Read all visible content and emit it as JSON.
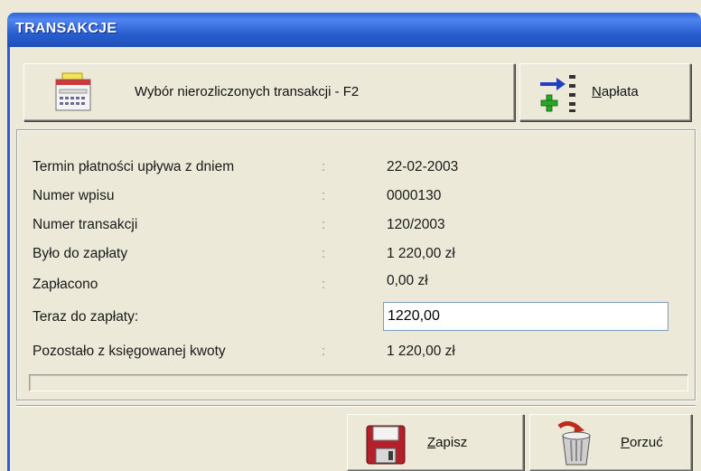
{
  "window": {
    "title": "TRANSAKCJE"
  },
  "toolbar": {
    "select_label": "Wybór nierozliczonych transakcji - F2",
    "payment_label_underlined": "N",
    "payment_label_rest": "apłata"
  },
  "fields": [
    {
      "label": "Termin płatności upływa z dniem",
      "colon": ":",
      "value": "22-02-2003"
    },
    {
      "label": "Numer wpisu",
      "colon": ":",
      "value": "0000130"
    },
    {
      "label": "Numer transakcji",
      "colon": ":",
      "value": "120/2003"
    },
    {
      "label": "Było do zapłaty",
      "colon": ":",
      "value": "1 220,00 zł"
    },
    {
      "label": "Zapłacono",
      "colon": ":",
      "value": "0,00 zł"
    },
    {
      "label": "Teraz do zapłaty:",
      "value": "1220,00"
    },
    {
      "label": "Pozostało z księgowanej kwoty",
      "colon": ":",
      "value": "1 220,00 zł"
    }
  ],
  "footer": {
    "save_underlined": "Z",
    "save_rest": "apisz",
    "cancel_underlined": "P",
    "cancel_rest": "orzuć"
  },
  "colors": {
    "titlebar": "#2a5fd1",
    "window_bg": "#ece9d8"
  }
}
